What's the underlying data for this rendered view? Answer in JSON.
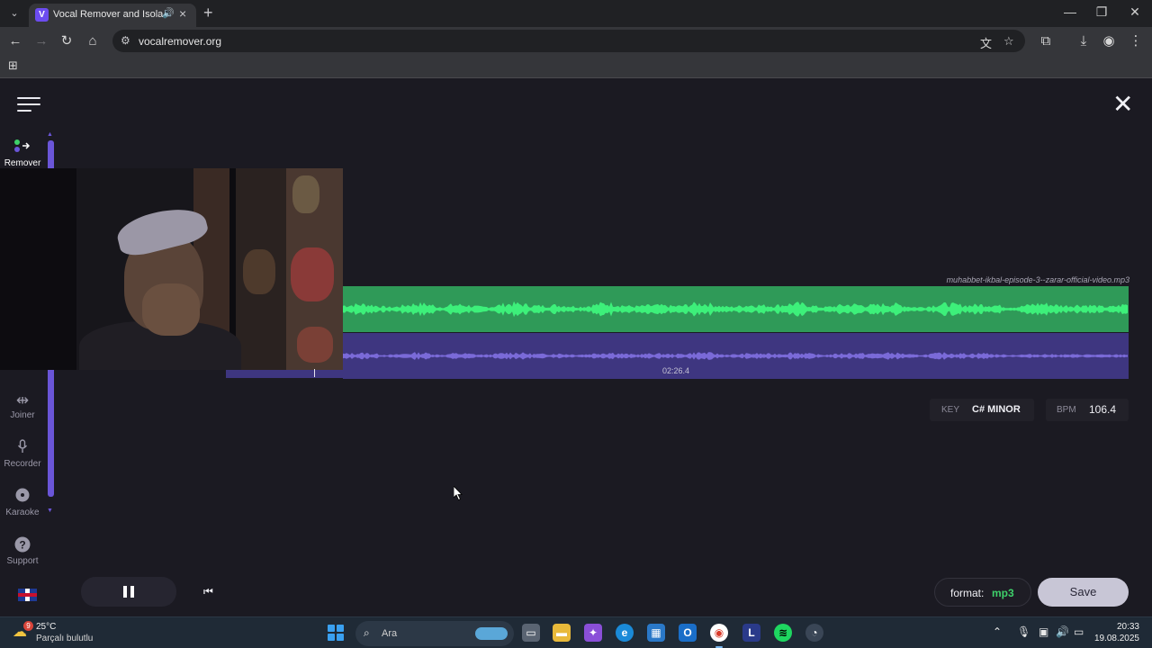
{
  "browser": {
    "tab_title": "Vocal Remover and Isolation",
    "url": "vocalremover.org",
    "new_tab": "+",
    "tab_close": "×"
  },
  "sidebar": {
    "items": [
      {
        "label": "Remover",
        "icon": "remover-icon",
        "active": true
      },
      {
        "label": "Joiner",
        "icon": "joiner-icon"
      },
      {
        "label": "Recorder",
        "icon": "microphone-icon"
      },
      {
        "label": "Karaoke",
        "icon": "disc-icon"
      },
      {
        "label": "Support",
        "icon": "help-icon"
      }
    ],
    "language": "en-gb-flag"
  },
  "editor": {
    "filename": "muhabbet-ikbal-episode-3--zarar-official-video.mp3",
    "current_time": "02:26.4",
    "playback_progress": 0.098
  },
  "analysis": {
    "key_label": "KEY",
    "key_value": "C# MINOR",
    "bpm_label": "BPM",
    "bpm_value": "106.4"
  },
  "controls": {
    "format_label": "format:",
    "format_value": "mp3",
    "save_label": "Save"
  },
  "colors": {
    "music_track": "#2f9a58",
    "music_wave": "#3df07a",
    "vocal_track": "#3e3680",
    "vocal_wave": "#7a6ad8",
    "accent": "#6a55d8",
    "format_accent": "#3ed06a"
  },
  "taskbar": {
    "weather_temp": "25°C",
    "weather_desc": "Parçalı bulutlu",
    "weather_badge": "9",
    "search_text": "Ara",
    "time": "20:33",
    "date": "19.08.2025"
  }
}
